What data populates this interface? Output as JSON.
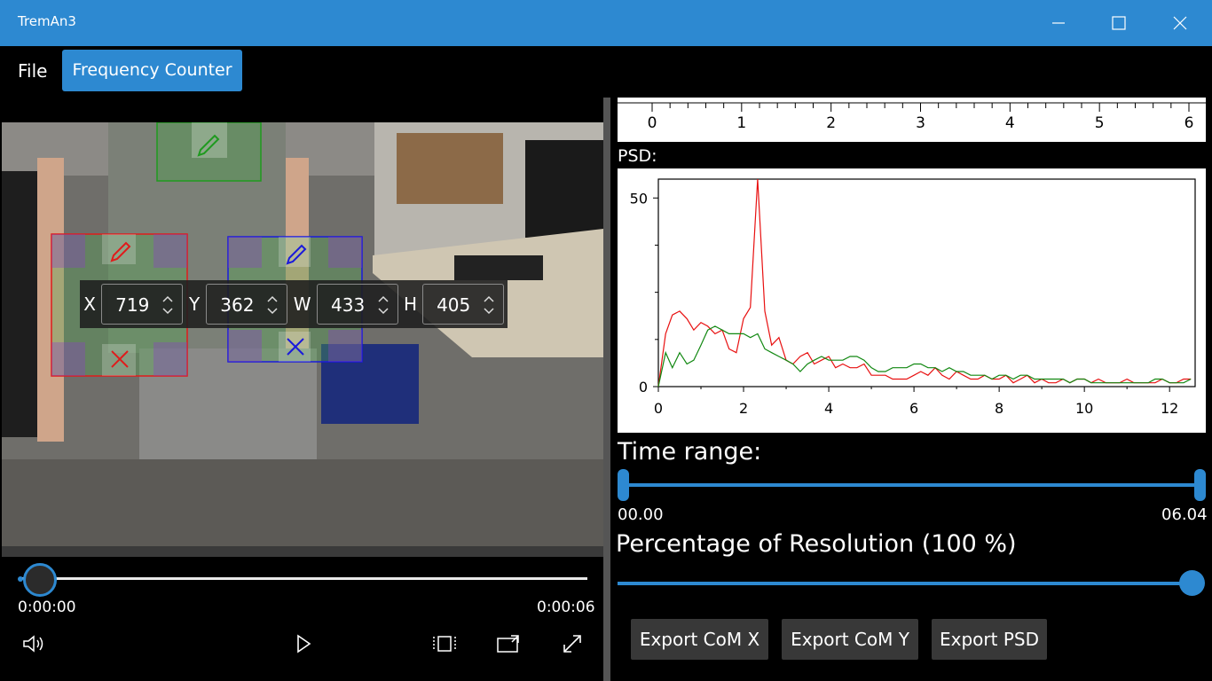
{
  "window": {
    "title": "TremAn3",
    "minimize_icon": "minimize-icon",
    "maximize_icon": "maximize-icon",
    "close_icon": "close-icon"
  },
  "menu": {
    "file_label": "File",
    "frequency_counter_label": "Frequency Counter"
  },
  "roi": {
    "x_label": "X",
    "x_value": "719",
    "y_label": "Y",
    "y_value": "362",
    "w_label": "W",
    "w_value": "433",
    "h_label": "H",
    "h_value": "405"
  },
  "player": {
    "current_time": "0:00:00",
    "total_time": "0:00:06",
    "position_fraction": 0.0,
    "icons": [
      "volume-icon",
      "play-icon",
      "aspect-ratio-icon",
      "cast-icon",
      "fullscreen-icon"
    ]
  },
  "top_axis": {
    "ticks": [
      "0",
      "1",
      "2",
      "3",
      "4",
      "5",
      "6"
    ]
  },
  "psd": {
    "label": "PSD:",
    "chart_data": {
      "type": "line",
      "xlim": [
        0,
        12.6
      ],
      "ylim": [
        0,
        55
      ],
      "x_ticks": [
        "0",
        "2",
        "4",
        "6",
        "8",
        "10",
        "12"
      ],
      "y_ticks": [
        "0",
        "50"
      ],
      "series": [
        {
          "color": "#e81010",
          "x": [
            0,
            0.17,
            0.33,
            0.5,
            0.67,
            0.83,
            1.0,
            1.16,
            1.33,
            1.5,
            1.66,
            1.83,
            2.0,
            2.16,
            2.33,
            2.5,
            2.66,
            2.83,
            3.0,
            3.16,
            3.33,
            3.5,
            3.66,
            3.83,
            4.0,
            4.16,
            4.33,
            4.5,
            4.66,
            4.83,
            5.0,
            5.16,
            5.33,
            5.5,
            5.66,
            5.83,
            6.0,
            6.16,
            6.33,
            6.5,
            6.66,
            6.83,
            7.0,
            7.16,
            7.33,
            7.5,
            7.66,
            7.83,
            8.0,
            8.16,
            8.33,
            8.5,
            8.66,
            8.83,
            9.0,
            9.16,
            9.33,
            9.5,
            9.66,
            9.83,
            10.0,
            10.16,
            10.33,
            10.5,
            10.66,
            10.83,
            11.0,
            11.16,
            11.33,
            11.5,
            11.66,
            11.83,
            12.0,
            12.16,
            12.33,
            12.5
          ],
          "y": [
            0,
            14,
            19,
            20,
            18,
            15,
            17,
            16,
            14,
            15,
            10,
            9,
            18,
            21,
            55,
            20,
            11,
            13,
            7,
            6,
            8,
            9,
            6,
            7,
            8,
            5,
            6,
            5,
            5,
            6,
            3,
            3,
            3,
            2,
            2,
            2,
            3,
            4,
            3,
            5,
            3,
            2,
            4,
            3,
            2,
            2,
            3,
            2,
            2,
            3,
            1,
            2,
            3,
            1,
            2,
            1,
            1,
            2,
            1,
            2,
            2,
            1,
            2,
            1,
            1,
            1,
            2,
            1,
            1,
            1,
            1,
            2,
            1,
            1,
            2,
            2
          ]
        },
        {
          "color": "#118811",
          "x": [
            0,
            0.17,
            0.33,
            0.5,
            0.67,
            0.83,
            1.0,
            1.16,
            1.33,
            1.5,
            1.66,
            1.83,
            2.0,
            2.16,
            2.33,
            2.5,
            2.66,
            2.83,
            3.0,
            3.16,
            3.33,
            3.5,
            3.66,
            3.83,
            4.0,
            4.16,
            4.33,
            4.5,
            4.66,
            4.83,
            5.0,
            5.16,
            5.33,
            5.5,
            5.66,
            5.83,
            6.0,
            6.16,
            6.33,
            6.5,
            6.66,
            6.83,
            7.0,
            7.16,
            7.33,
            7.5,
            7.66,
            7.83,
            8.0,
            8.16,
            8.33,
            8.5,
            8.66,
            8.83,
            9.0,
            9.16,
            9.33,
            9.5,
            9.66,
            9.83,
            10.0,
            10.16,
            10.33,
            10.5,
            10.66,
            10.83,
            11.0,
            11.16,
            11.33,
            11.5,
            11.66,
            11.83,
            12.0,
            12.16,
            12.33,
            12.5
          ],
          "y": [
            0,
            9,
            5,
            9,
            6,
            7,
            11,
            15,
            16,
            15,
            14,
            14,
            14,
            13,
            14,
            10,
            9,
            8,
            7,
            6,
            4,
            6,
            7,
            8,
            7,
            7,
            7,
            8,
            8,
            7,
            5,
            4,
            4,
            5,
            5,
            5,
            6,
            6,
            5,
            5,
            4,
            5,
            4,
            4,
            3,
            3,
            3,
            2,
            3,
            3,
            2,
            3,
            3,
            2,
            2,
            2,
            2,
            2,
            1,
            2,
            2,
            1,
            1,
            1,
            1,
            1,
            1,
            1,
            1,
            1,
            2,
            2,
            1,
            1,
            1,
            2
          ]
        }
      ]
    }
  },
  "time_range": {
    "label": "Time range:",
    "start": "00.00",
    "end": "06.04"
  },
  "resolution": {
    "label": "Percentage of Resolution (100 %)",
    "value_percent": 100
  },
  "export": {
    "com_x": "Export CoM X",
    "com_y": "Export CoM Y",
    "psd": "Export PSD"
  },
  "colors": {
    "accent": "#2d89d1",
    "roi_red": "#e01b1b",
    "roi_blue": "#1a1adb",
    "roi_green": "#1f9a1f"
  }
}
